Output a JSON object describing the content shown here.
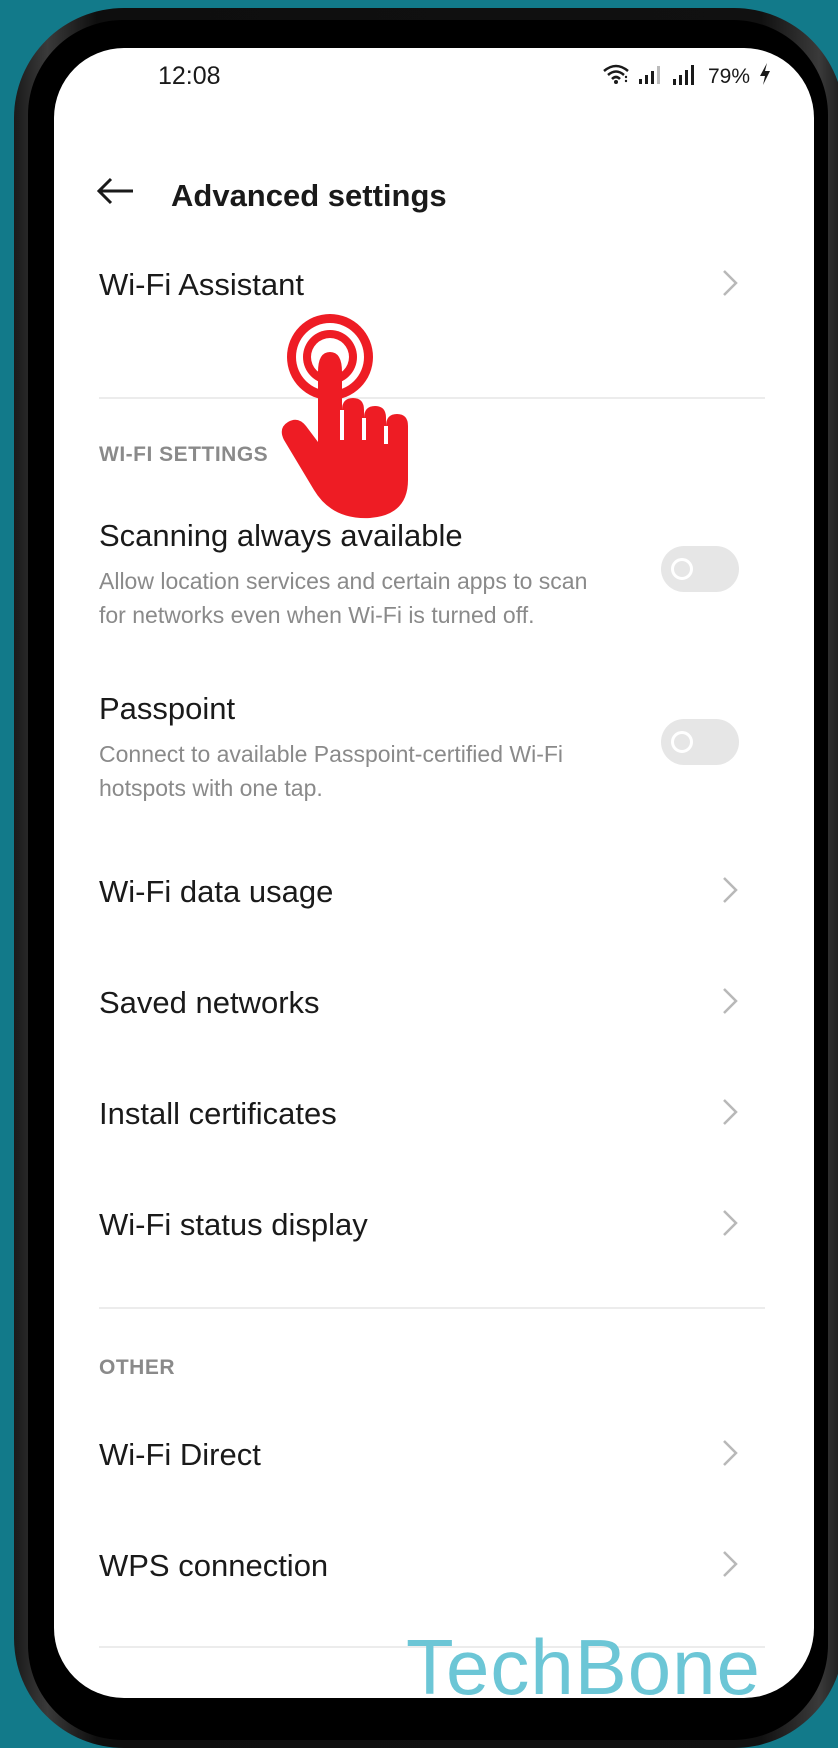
{
  "status_bar": {
    "time": "12:08",
    "battery": "79%",
    "icons": [
      "wifi-icon",
      "signal-icon",
      "signal-icon",
      "battery-charging-icon"
    ]
  },
  "header": {
    "back_icon": "arrow-left-icon",
    "title": "Advanced settings"
  },
  "wifi_assistant": {
    "label": "Wi-Fi Assistant"
  },
  "wifi_settings": {
    "section_label": "WI-FI SETTINGS",
    "scanning": {
      "title": "Scanning always available",
      "description": "Allow location services and certain apps to scan for networks even when Wi-Fi is turned off.",
      "enabled": false
    },
    "passpoint": {
      "title": "Passpoint",
      "description": "Connect to available Passpoint-certified Wi-Fi hotspots with one tap.",
      "enabled": false
    },
    "items": [
      {
        "label": "Wi-Fi data usage"
      },
      {
        "label": "Saved networks"
      },
      {
        "label": "Install certificates"
      },
      {
        "label": "Wi-Fi status display"
      }
    ]
  },
  "other": {
    "section_label": "OTHER",
    "items": [
      {
        "label": "Wi-Fi Direct"
      },
      {
        "label": "WPS connection"
      }
    ]
  },
  "watermark": "TechBone",
  "colors": {
    "background": "#127a8a",
    "tap_indicator": "#ee1c24",
    "watermark": "#6cc6d6"
  }
}
